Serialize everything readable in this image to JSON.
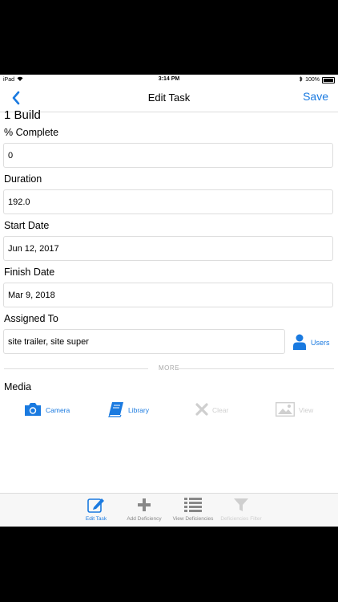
{
  "status": {
    "device": "iPad",
    "time": "3:14 PM",
    "battery": "100%"
  },
  "nav": {
    "title": "Edit Task",
    "save_label": "Save"
  },
  "task_title": "1 Build",
  "fields": {
    "percent_complete": {
      "label": "% Complete",
      "value": "0"
    },
    "duration": {
      "label": "Duration",
      "value": "192.0"
    },
    "start_date": {
      "label": "Start Date",
      "value": "Jun 12, 2017"
    },
    "finish_date": {
      "label": "Finish Date",
      "value": "Mar 9, 2018"
    },
    "assigned_to": {
      "label": "Assigned To",
      "value": "site trailer, site super",
      "users_label": "Users"
    }
  },
  "more_label": "MORE",
  "media": {
    "title": "Media",
    "camera": "Camera",
    "library": "Library",
    "clear": "Clear",
    "view": "View"
  },
  "tabbar": {
    "edit_task": "Edit Task",
    "add_deficiency": "Add Deficiency",
    "view_deficiencies": "View Deficiencies",
    "deficiencies_filter": "Deficiencies Filter"
  },
  "colors": {
    "accent": "#1a7ae0",
    "disabled": "#cfcfcf",
    "border": "#dddddd"
  }
}
